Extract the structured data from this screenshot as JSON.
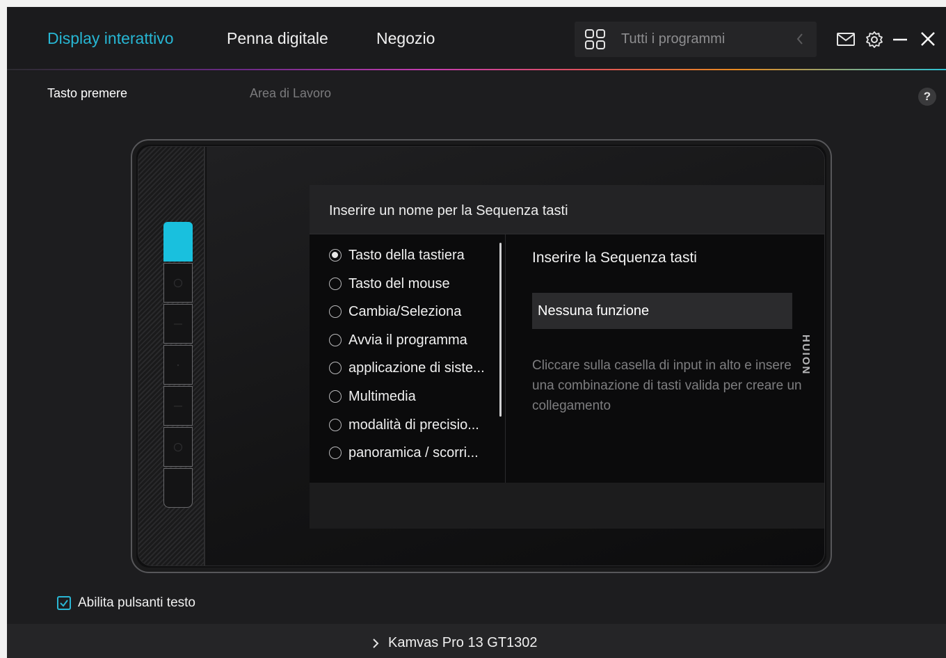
{
  "nav": {
    "tabs": [
      {
        "label": "Display interattivo",
        "active": true
      },
      {
        "label": "Penna digitale",
        "active": false
      },
      {
        "label": "Negozio",
        "active": false
      }
    ],
    "programs_label": "Tutti i programmi",
    "icons": [
      "grid-icon",
      "chevron-left-icon",
      "mail-icon",
      "gear-icon",
      "minimize-icon",
      "close-icon"
    ]
  },
  "subtabs": [
    {
      "label": "Tasto premere",
      "active": true
    },
    {
      "label": "Area di Lavoro",
      "active": false
    }
  ],
  "help_label": "?",
  "tablet": {
    "brand": "HUION",
    "selected_key": 1,
    "key_count": 7
  },
  "dialog": {
    "title": "Inserire un nome per la Sequenza tasti",
    "options": [
      {
        "label": "Tasto della tastiera",
        "selected": true
      },
      {
        "label": "Tasto del mouse",
        "selected": false
      },
      {
        "label": "Cambia/Seleziona",
        "selected": false
      },
      {
        "label": "Avvia il programma",
        "selected": false
      },
      {
        "label": "applicazione di siste...",
        "selected": false
      },
      {
        "label": "Multimedia",
        "selected": false
      },
      {
        "label": "modalità di precisio...",
        "selected": false
      },
      {
        "label": "panoramica / scorri...",
        "selected": false
      }
    ],
    "right_title": "Inserire la Sequenza tasti",
    "input_value": "Nessuna funzione",
    "hint": "Cliccare sulla casella di input in alto e insere una combinazione di tasti valida per creare un collegamento"
  },
  "enable_text_buttons": {
    "label": "Abilita pulsanti testo",
    "checked": true
  },
  "device": {
    "label": "Kamvas Pro 13 GT1302"
  },
  "colors": {
    "accent": "#27b6d3",
    "selected_key": "#19c0de",
    "background": "#1d1d1f"
  }
}
